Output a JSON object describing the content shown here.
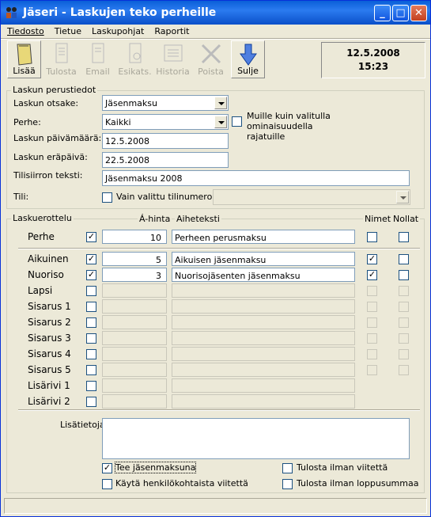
{
  "window": {
    "title": "Jäseri - Laskujen teko perheille",
    "min": "_",
    "max": "□",
    "close": "✕"
  },
  "menu": [
    "Tiedosto",
    "Tietue",
    "Laskupohjat",
    "Raportit"
  ],
  "toolbar": [
    {
      "label": "Lisää",
      "icon": "book-icon",
      "enabled": true
    },
    {
      "label": "Tulosta",
      "icon": "printer-icon",
      "enabled": false
    },
    {
      "label": "Email",
      "icon": "envelope-icon",
      "enabled": false
    },
    {
      "label": "Esikats.",
      "icon": "preview-icon",
      "enabled": false
    },
    {
      "label": "Historia",
      "icon": "history-icon",
      "enabled": false
    },
    {
      "label": "Poista",
      "icon": "delete-icon",
      "enabled": false
    },
    {
      "label": "Sulje",
      "icon": "down-arrow-icon",
      "enabled": true
    }
  ],
  "clock": {
    "date": "12.5.2008",
    "time": "15:23"
  },
  "basics": {
    "legend": "Laskun perustiedot",
    "subject_label": "Laskun otsake:",
    "subject_value": "Jäsenmaksu",
    "family_label": "Perhe:",
    "family_value": "Kaikki",
    "other_filter_label": "Muille kuin valitulla ominaisuudella rajatuille",
    "date_label": "Laskun päivämäärä:",
    "date_value": "12.5.2008",
    "due_label": "Laskun eräpäivä:",
    "due_value": "22.5.2008",
    "transfer_label": "Tilisiirron teksti:",
    "transfer_value": "Jäsenmaksu 2008",
    "account_label": "Tili:",
    "account_check_label": "Vain valittu tilinumero"
  },
  "breakdown": {
    "legend": "Laskuerottelu",
    "col_price": "Á-hinta",
    "col_subject": "Aiheteksti",
    "col_names": "Nimet",
    "col_zero": "Nollat",
    "rows": [
      {
        "label": "Perhe",
        "checked": true,
        "price": "10",
        "text": "Perheen perusmaksu",
        "names": false,
        "zero": false,
        "active": true
      },
      {
        "label": "Aikuinen",
        "checked": true,
        "price": "5",
        "text": "Aikuisen jäsenmaksu",
        "names": true,
        "zero": false,
        "active": true
      },
      {
        "label": "Nuoriso",
        "checked": true,
        "price": "3",
        "text": "Nuorisojäsenten jäsenmaksu",
        "names": true,
        "zero": false,
        "active": true
      },
      {
        "label": "Lapsi",
        "checked": false,
        "price": "",
        "text": "",
        "names": false,
        "zero": false,
        "active": false
      },
      {
        "label": "Sisarus 1",
        "checked": false,
        "price": "",
        "text": "",
        "names": false,
        "zero": false,
        "active": false
      },
      {
        "label": "Sisarus 2",
        "checked": false,
        "price": "",
        "text": "",
        "names": false,
        "zero": false,
        "active": false
      },
      {
        "label": "Sisarus 3",
        "checked": false,
        "price": "",
        "text": "",
        "names": false,
        "zero": false,
        "active": false
      },
      {
        "label": "Sisarus 4",
        "checked": false,
        "price": "",
        "text": "",
        "names": false,
        "zero": false,
        "active": false
      },
      {
        "label": "Sisarus 5",
        "checked": false,
        "price": "",
        "text": "",
        "names": false,
        "zero": false,
        "active": false
      },
      {
        "label": "Lisärivi 1",
        "checked": false,
        "price": "",
        "text": "",
        "names": null,
        "zero": null,
        "active": false
      },
      {
        "label": "Lisärivi 2",
        "checked": false,
        "price": "",
        "text": "",
        "names": null,
        "zero": null,
        "active": false
      }
    ],
    "extra_label": "Lisätietoja:"
  },
  "options": {
    "membership": "Tee jäsenmaksuna",
    "membership_checked": true,
    "personal_ref": "Käytä henkilökohtaista viitettä",
    "personal_ref_checked": false,
    "no_ref": "Tulosta ilman viitettä",
    "no_ref_checked": false,
    "no_total": "Tulosta ilman loppusummaa",
    "no_total_checked": false
  }
}
